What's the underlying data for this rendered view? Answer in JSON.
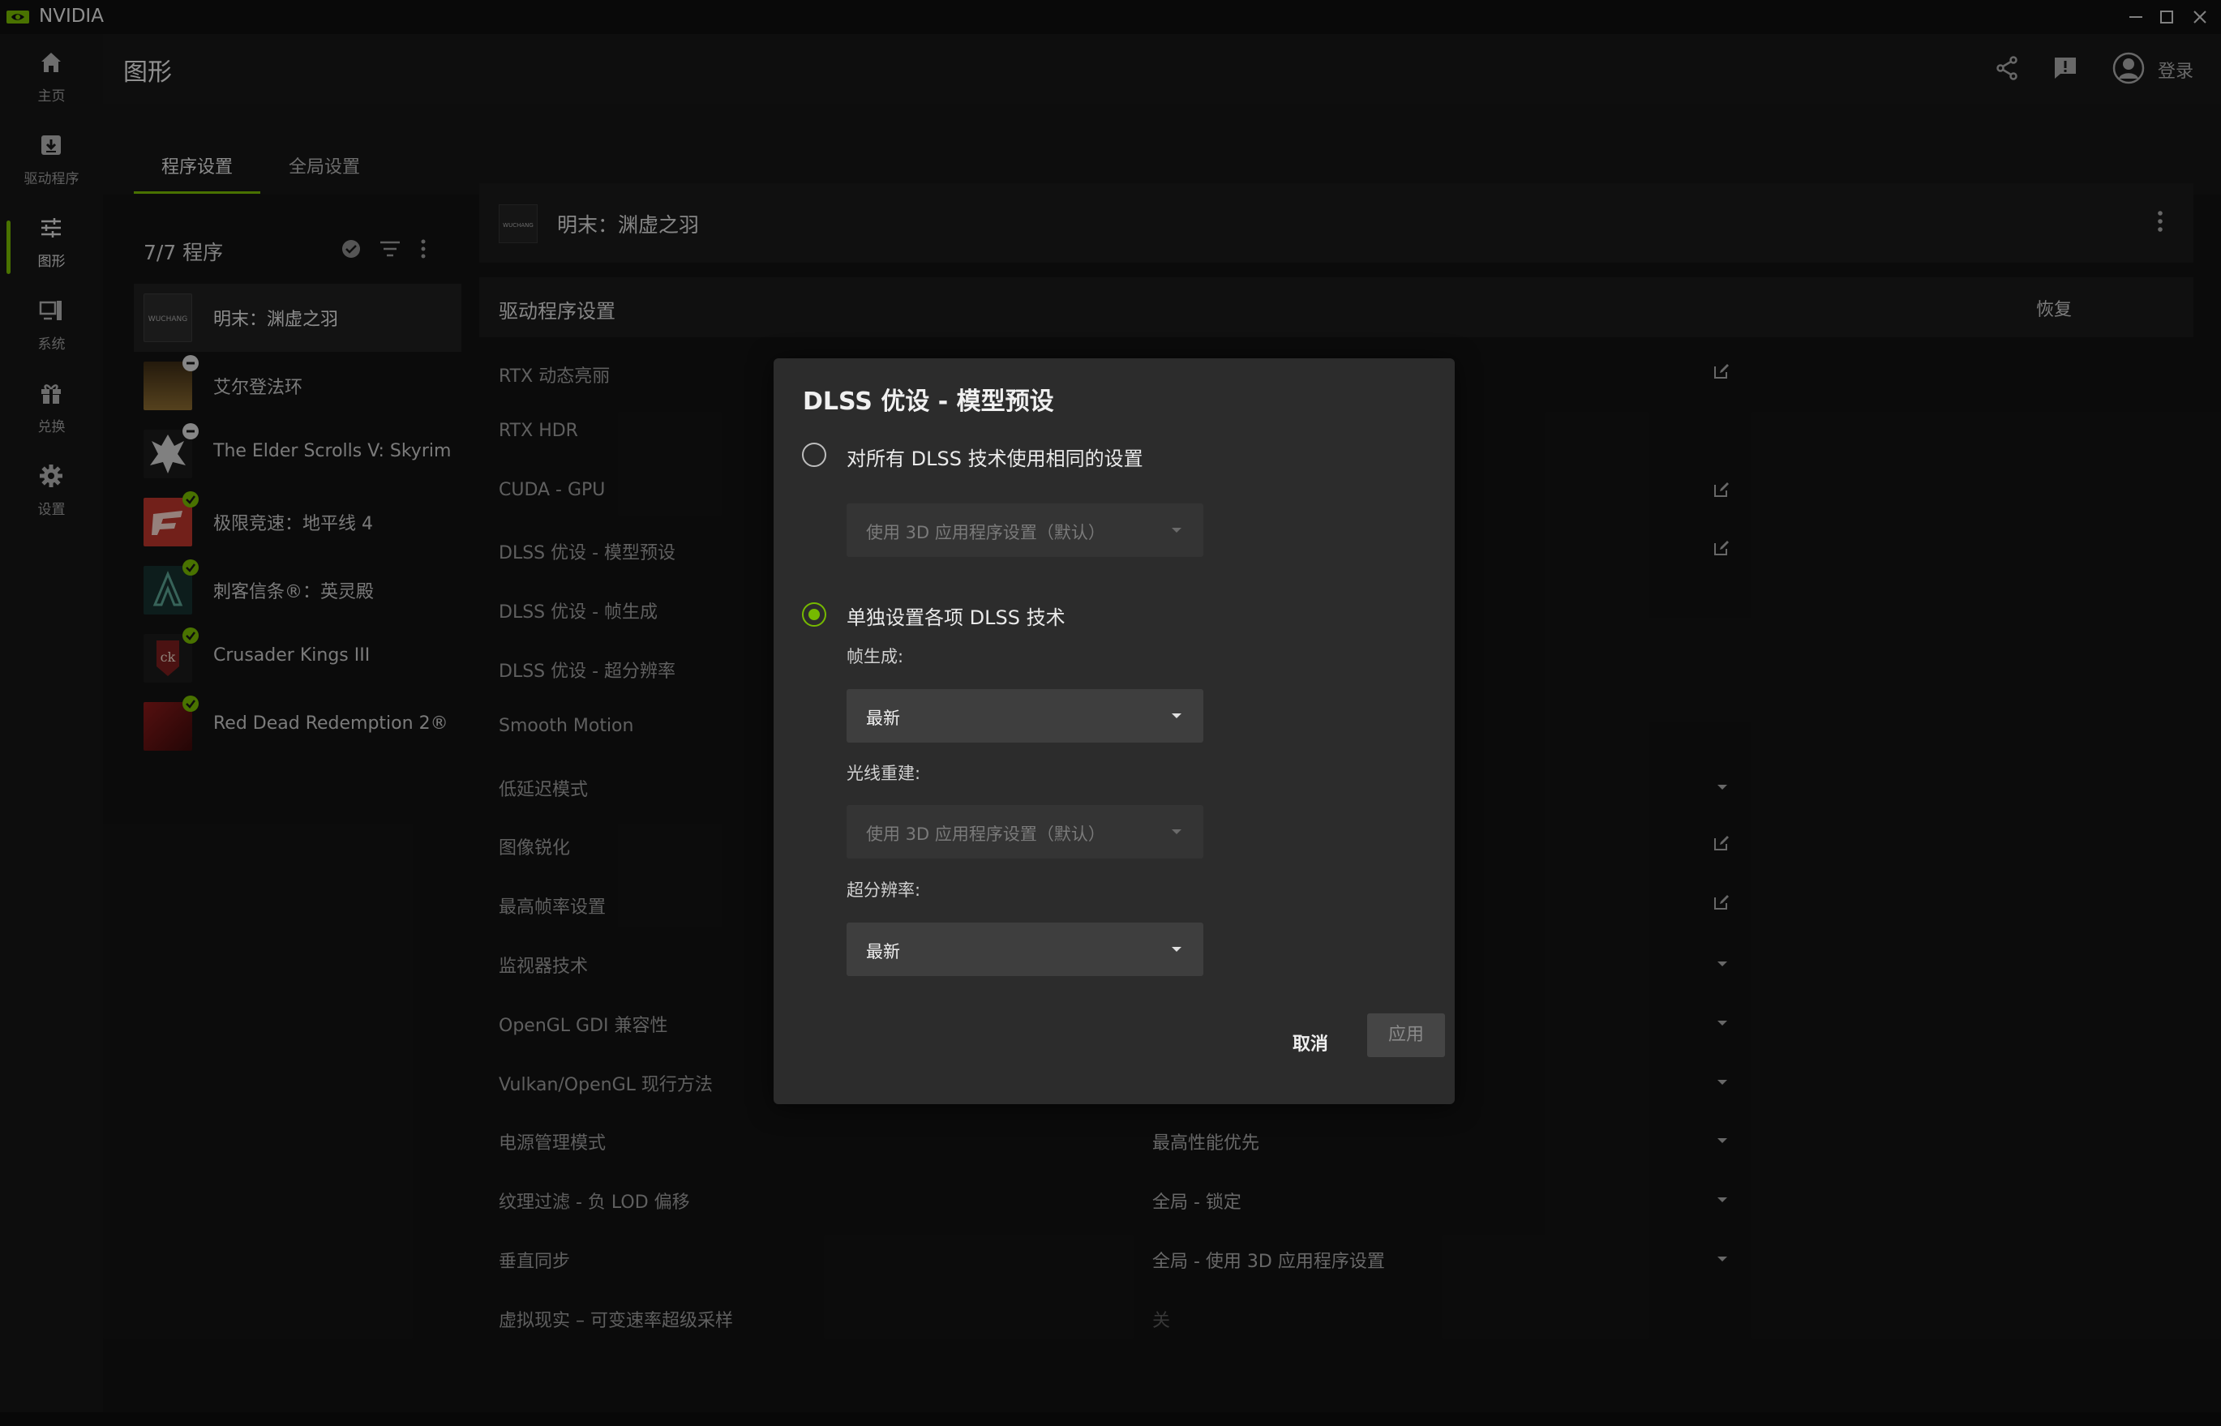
{
  "window": {
    "title": "NVIDIA"
  },
  "rail": [
    {
      "label": "主页",
      "icon": "home-icon"
    },
    {
      "label": "驱动程序",
      "icon": "driver-icon"
    },
    {
      "label": "图形",
      "icon": "sliders-icon"
    },
    {
      "label": "系统",
      "icon": "system-icon"
    },
    {
      "label": "兑换",
      "icon": "gift-icon"
    },
    {
      "label": "设置",
      "icon": "gear-icon"
    }
  ],
  "header": {
    "title": "图形",
    "login": "登录"
  },
  "tabs": [
    "程序设置",
    "全局设置"
  ],
  "programs": {
    "count": "7/7 程序",
    "items": [
      {
        "name": "明末：渊虚之羽",
        "status": "none",
        "color": "#2a2a2a"
      },
      {
        "name": "艾尔登法环",
        "status": "minus",
        "color": "#6b4a24"
      },
      {
        "name": "The Elder Scrolls V: Skyrim S...",
        "status": "minus",
        "color": "#3a3a3a"
      },
      {
        "name": "极限竞速：地平线 4",
        "status": "check",
        "color": "#b8342a"
      },
      {
        "name": "刺客信条®：英灵殿",
        "status": "check",
        "color": "#1e3a3a"
      },
      {
        "name": "Crusader Kings III",
        "status": "check",
        "color": "#5a1e1e"
      },
      {
        "name": "Red Dead Redemption 2®",
        "status": "check",
        "color": "#7a1a1a"
      }
    ]
  },
  "game": {
    "title": "明末：渊虚之羽"
  },
  "section": {
    "title": "驱动程序设置",
    "restore": "恢复"
  },
  "settings": [
    {
      "label": "RTX 动态亮丽",
      "value": "",
      "control": "edit"
    },
    {
      "label": "RTX HDR",
      "value": "",
      "control": "none"
    },
    {
      "label": "CUDA - GPU",
      "value": "",
      "control": "edit"
    },
    {
      "label": "DLSS 优设 - 模型预设",
      "value": "",
      "control": "edit"
    },
    {
      "label": "DLSS 优设 - 帧生成",
      "value": "",
      "control": "none"
    },
    {
      "label": "DLSS 优设 - 超分辨率",
      "value": "",
      "control": "none"
    },
    {
      "label": "Smooth Motion",
      "value": "",
      "control": "none"
    },
    {
      "label": "低延迟模式",
      "value": "",
      "control": "caret"
    },
    {
      "label": "图像锐化",
      "value": "",
      "control": "edit"
    },
    {
      "label": "最高帧率设置",
      "value": "",
      "control": "edit"
    },
    {
      "label": "监视器技术",
      "value": "",
      "control": "caret"
    },
    {
      "label": "OpenGL GDI 兼容性",
      "value": "",
      "control": "caret"
    },
    {
      "label": "Vulkan/OpenGL 现行方法",
      "value": "",
      "control": "caret"
    },
    {
      "label": "电源管理模式",
      "value": "最高性能优先",
      "control": "caret"
    },
    {
      "label": "纹理过滤 - 负 LOD 偏移",
      "value": "全局 - 锁定",
      "control": "caret"
    },
    {
      "label": "垂直同步",
      "value": "全局 - 使用 3D 应用程序设置",
      "control": "caret"
    },
    {
      "label": "虚拟现实 – 可变速率超级采样",
      "value": "关",
      "control": "none",
      "dim": true
    }
  ],
  "dialog": {
    "title": "DLSS 优设 - 模型预设",
    "option_same": "对所有 DLSS 技术使用相同的设置",
    "option_same_select": "使用 3D 应用程序设置（默认）",
    "option_individual": "单独设置各项 DLSS 技术",
    "frame_gen_label": "帧生成:",
    "frame_gen_value": "最新",
    "ray_recon_label": "光线重建:",
    "ray_recon_value": "使用 3D 应用程序设置（默认）",
    "super_res_label": "超分辨率:",
    "super_res_value": "最新",
    "cancel": "取消",
    "apply": "应用",
    "selected_option": "individual"
  },
  "colors": {
    "accent": "#76b900",
    "background": "#131313",
    "dialog": "#2c2c2c"
  }
}
